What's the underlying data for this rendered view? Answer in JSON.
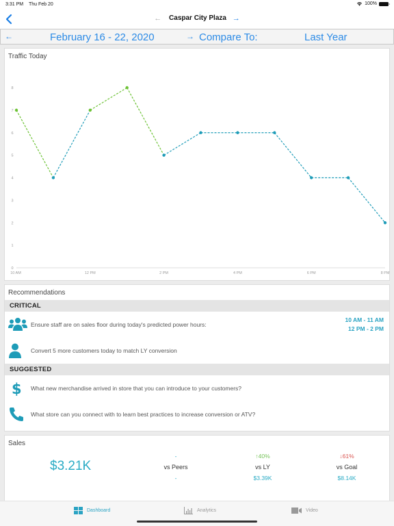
{
  "status_bar": {
    "time": "3:31 PM",
    "date": "Thu Feb 20",
    "battery": "100%"
  },
  "nav": {
    "back_icon": "chevron-left-icon",
    "store_name": "Caspar City Plaza",
    "prev_arrow": "←",
    "next_arrow": "→"
  },
  "date_bar": {
    "prev_arrow": "←",
    "range": "February 16 - 22, 2020",
    "next_arrow": "→",
    "compare_label": "Compare To:",
    "compare_value": "Last Year"
  },
  "traffic": {
    "title": "Traffic Today"
  },
  "chart_data": {
    "type": "line",
    "title": "Traffic Today",
    "xlabel": "",
    "ylabel": "",
    "x": [
      "10 AM",
      "11 AM",
      "12 PM",
      "1 PM",
      "2 PM",
      "3 PM",
      "4 PM",
      "5 PM",
      "6 PM",
      "7 PM",
      "8 PM"
    ],
    "x_tick_labels": [
      "10 AM",
      "12 PM",
      "2 PM",
      "4 PM",
      "6 PM",
      "8 PM"
    ],
    "values": [
      7,
      4,
      7,
      8,
      5,
      6,
      6,
      6,
      4,
      4,
      2
    ],
    "highlighted": [
      true,
      false,
      true,
      true,
      false,
      false,
      false,
      false,
      false,
      false,
      false
    ],
    "ylim": [
      0,
      8
    ],
    "y_ticks": [
      0,
      1,
      2,
      3,
      4,
      5,
      6,
      7,
      8
    ],
    "line_style": "dashed",
    "grid": false,
    "colors": {
      "normal": "#1e9cb8",
      "highlight": "#6cc234"
    }
  },
  "recommendations": {
    "title": "Recommendations",
    "critical": {
      "label": "CRITICAL",
      "items": [
        {
          "icon": "users-group-icon",
          "text": "Ensure staff are on sales floor during today's predicted power hours:",
          "power_hours": [
            "10 AM - 11 AM",
            "12 PM - 2 PM"
          ]
        },
        {
          "icon": "user-icon",
          "text": "Convert 5 more customers today to match LY conversion"
        }
      ]
    },
    "suggested": {
      "label": "SUGGESTED",
      "items": [
        {
          "icon": "dollar-icon",
          "text": "What new merchandise arrived in store that you can introduce to your customers?"
        },
        {
          "icon": "phone-icon",
          "text": "What store can you connect with to learn best practices to increase conversion or ATV?"
        }
      ]
    }
  },
  "sales": {
    "title": "Sales",
    "value": "$3.21K",
    "metrics": [
      {
        "top": "-",
        "label": "vs Peers",
        "bottom": "-",
        "direction": "none"
      },
      {
        "top": "↑40%",
        "label": "vs LY",
        "bottom": "$3.39K",
        "direction": "up"
      },
      {
        "top": "↓61%",
        "label": "vs Goal",
        "bottom": "$8.14K",
        "direction": "down"
      }
    ]
  },
  "tabs": [
    {
      "label": "Dashboard",
      "icon": "dashboard-grid-icon",
      "active": true
    },
    {
      "label": "Analytics",
      "icon": "bar-chart-icon",
      "active": false
    },
    {
      "label": "Video",
      "icon": "video-camera-icon",
      "active": false
    }
  ],
  "colors": {
    "accent_blue": "#2b8ae6",
    "teal": "#2aabc5",
    "green": "#6cc234",
    "red": "#d9534f"
  }
}
